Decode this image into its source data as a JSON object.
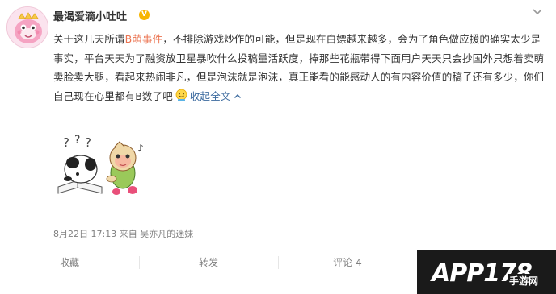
{
  "user": {
    "name": "最渴爱滴小吐吐",
    "verified_badge": "V"
  },
  "post": {
    "text_before_tag": "关于这几天所谓",
    "hashtag": "B萌事件",
    "text_after_tag": "，不排除游戏炒作的可能，但是现在白嫖越来越多，会为了角色做应援的确实太少是事实，平台天天为了融资放卫星暴吹什么投稿量活跃度，捧那些花瓶带得下面用户天天只会抄国外只想着卖萌卖脸卖大腿，看起来热闹非凡，但是泡沫就是泡沫，真正能看的能感动人的有内容价值的稿子还有多少，你们自己现在心里都有B数了吧",
    "collapse_label": "收起全文"
  },
  "meta": {
    "timestamp": "8月22日 17:13",
    "from_label": "来自",
    "source": "吴亦凡的迷妹"
  },
  "actions": {
    "favorite": "收藏",
    "repost": "转发",
    "comment": "评论 4",
    "like": ""
  },
  "watermark": {
    "main": "APP178",
    "sub": "手游网"
  },
  "colors": {
    "hashtag": "#eb7350",
    "link": "#3d6b9f",
    "meta": "#808080",
    "badge": "#f7b500"
  },
  "icons": {
    "avatar": "pink-character-avatar",
    "verify": "verified-badge-icon",
    "chevron": "chevron-down-icon",
    "emoji": "smiling-face-emoji",
    "collapse_arrow": "chevron-up-icon"
  }
}
